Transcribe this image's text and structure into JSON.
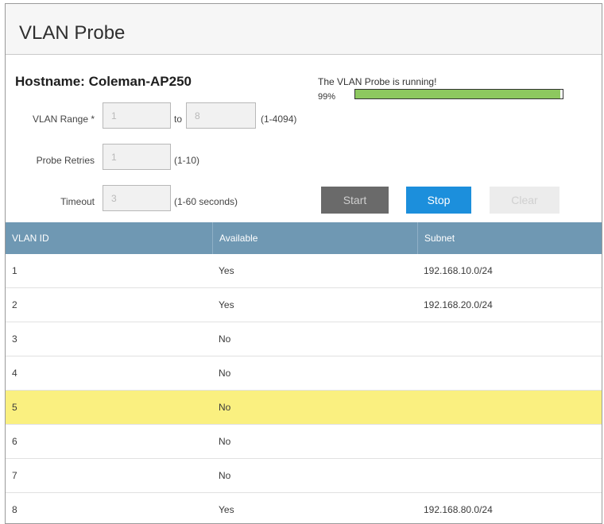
{
  "header": {
    "title": "VLAN Probe"
  },
  "hostname": "Hostname: Coleman-AP250",
  "form": {
    "vlan_range_label": "VLAN Range *",
    "range_from": "1",
    "range_sep": "to",
    "range_to": "8",
    "range_hint": "(1-4094)",
    "retries_label": "Probe Retries",
    "retries_value": "1",
    "retries_hint": "(1-10)",
    "timeout_label": "Timeout",
    "timeout_value": "3",
    "timeout_hint": "(1-60 seconds)"
  },
  "status": {
    "message": "The VLAN Probe is running!",
    "progress_label": "99%",
    "progress_fraction": 0.99,
    "progress_color": "#8dc85f"
  },
  "buttons": {
    "start": "Start",
    "stop": "Stop",
    "clear": "Clear"
  },
  "table": {
    "columns": [
      "VLAN ID",
      "Available",
      "Subnet"
    ],
    "rows": [
      {
        "id": "1",
        "available": "Yes",
        "subnet": "192.168.10.0/24",
        "highlight": false
      },
      {
        "id": "2",
        "available": "Yes",
        "subnet": "192.168.20.0/24",
        "highlight": false
      },
      {
        "id": "3",
        "available": "No",
        "subnet": "",
        "highlight": false
      },
      {
        "id": "4",
        "available": "No",
        "subnet": "",
        "highlight": false
      },
      {
        "id": "5",
        "available": "No",
        "subnet": "",
        "highlight": true
      },
      {
        "id": "6",
        "available": "No",
        "subnet": "",
        "highlight": false
      },
      {
        "id": "7",
        "available": "No",
        "subnet": "",
        "highlight": false
      },
      {
        "id": "8",
        "available": "Yes",
        "subnet": "192.168.80.0/24",
        "highlight": false
      }
    ]
  }
}
